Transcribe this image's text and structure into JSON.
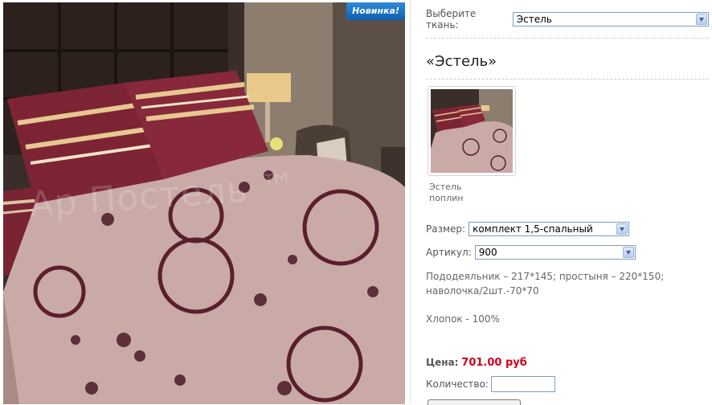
{
  "photo": {
    "badge": "Новинка!",
    "watermark": "Ар Постель ™"
  },
  "fabric": {
    "label": "Выберите ткань:",
    "value": "Эстель"
  },
  "product": {
    "title": "«Эстель»",
    "thumb_caption_line1": "Эстель",
    "thumb_caption_line2": "поплин"
  },
  "size": {
    "label": "Размер:",
    "value": "комплект 1,5-спальный"
  },
  "article": {
    "label": "Артикул:",
    "value": "900"
  },
  "description": {
    "line1": "Пододеяльник – 217*145; простыня – 220*150;",
    "line2": "наволочка/2шт.-70*70",
    "material": "Хлопок - 100%"
  },
  "price": {
    "label": "Цена:",
    "value": "701.00 руб"
  },
  "quantity": {
    "label": "Количество:",
    "value": ""
  },
  "colors": {
    "badge": "#1f74c8",
    "price": "#d0001e",
    "select_border": "#7f9db9"
  }
}
